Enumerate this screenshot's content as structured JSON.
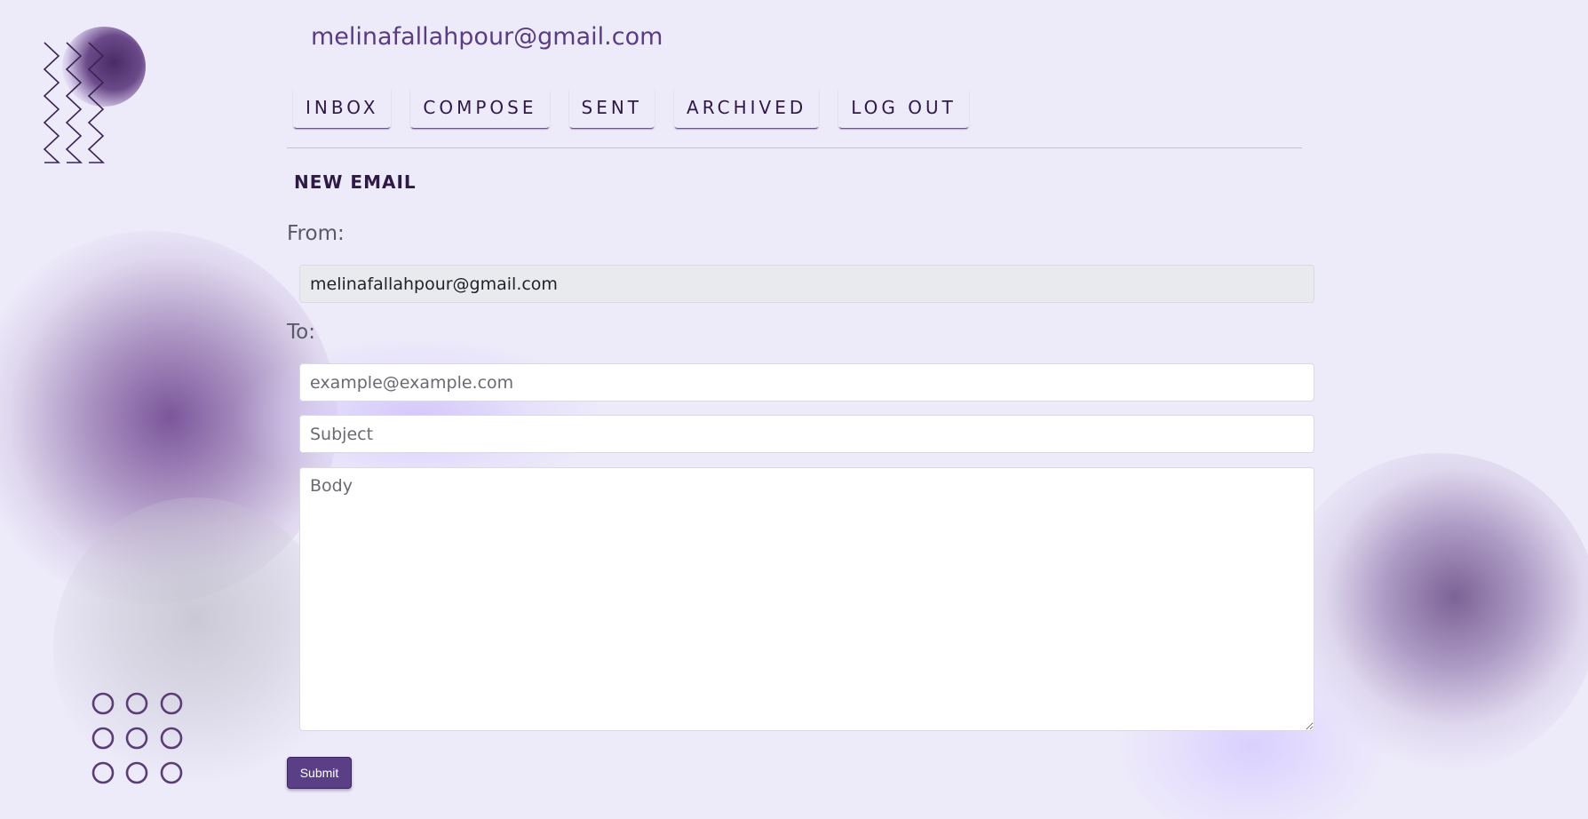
{
  "header": {
    "user_email": "melinafallahpour@gmail.com"
  },
  "nav": {
    "items": [
      {
        "label": "INBOX"
      },
      {
        "label": "COMPOSE"
      },
      {
        "label": "SENT"
      },
      {
        "label": "ARCHIVED"
      },
      {
        "label": "LOG OUT"
      }
    ]
  },
  "compose": {
    "title": "NEW EMAIL",
    "from_label": "From:",
    "from_value": "melinafallahpour@gmail.com",
    "to_label": "To:",
    "to_placeholder": "example@example.com",
    "subject_placeholder": "Subject",
    "body_placeholder": "Body",
    "submit_label": "Submit"
  },
  "theme": {
    "background": "#edeafa",
    "accent": "#5b3f86",
    "text_dark": "#2f1a46"
  }
}
